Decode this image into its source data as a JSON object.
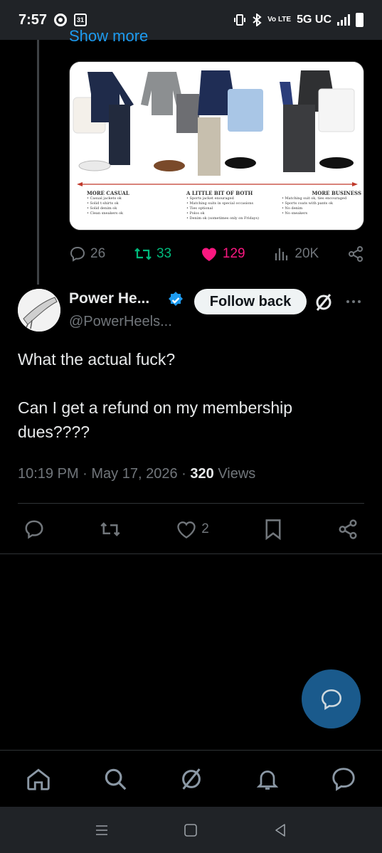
{
  "status_bar": {
    "time": "7:57",
    "calendar_day": "31",
    "network": "5G UC",
    "volte": "Vo LTE"
  },
  "quoted": {
    "show_more": "Show more",
    "media": {
      "columns": [
        {
          "heading": "MORE CASUAL",
          "items": [
            "• Casual jackets ok",
            "• Solid t-shirts ok",
            "• Solid denim ok",
            "• Clean sneakers ok"
          ]
        },
        {
          "heading": "A LITTLE BIT OF BOTH",
          "items": [
            "• Sports jacket enouraged",
            "• Matching suits in special occasions",
            "• Ties optional",
            "• Polos ok",
            "• Denim ok (sometimes only on Fridays)"
          ]
        },
        {
          "heading": "MORE BUSINESS",
          "items": [
            "• Matching suit ok, ties encouraged",
            "• Sports coats with pants ok",
            "• No denim",
            "• No sneakers"
          ]
        }
      ]
    },
    "stats": {
      "replies": "26",
      "retweets": "33",
      "likes": "129",
      "views": "20K"
    }
  },
  "tweet": {
    "display_name": "Power He...",
    "handle": "@PowerHeels...",
    "follow_label": "Follow back",
    "text_line1": "What the actual fuck?",
    "text_line2": "Can I get a refund on my membership dues????",
    "time": "10:19 PM",
    "date": "May 17, 2026",
    "views_count": "320",
    "views_label": "Views",
    "likes": "2"
  },
  "colors": {
    "accent": "#1d9bf0",
    "retweet": "#00ba7c",
    "like": "#f91880",
    "muted": "#71767b"
  }
}
